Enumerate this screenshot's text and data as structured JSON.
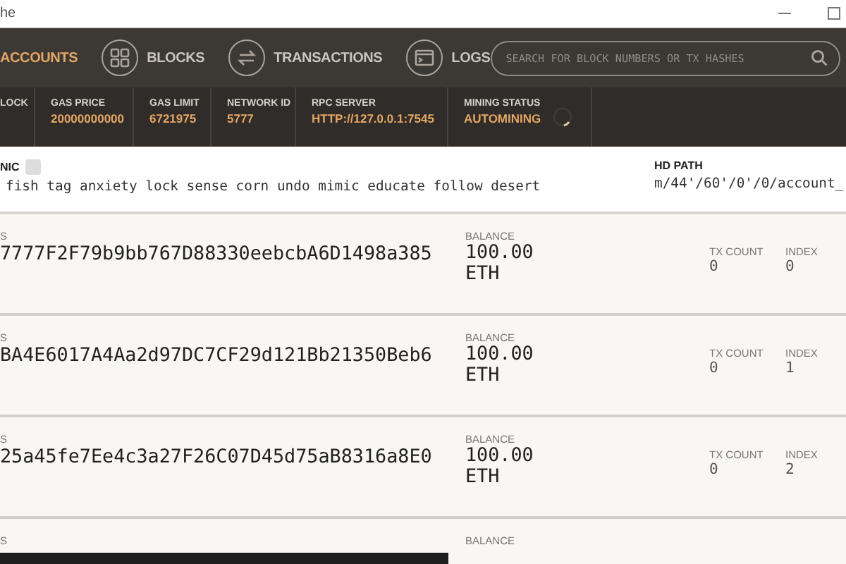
{
  "window": {
    "title": "he"
  },
  "nav": {
    "items": [
      {
        "label": "ACCOUNTS",
        "selected": true
      },
      {
        "label": "BLOCKS",
        "selected": false
      },
      {
        "label": "TRANSACTIONS",
        "selected": false
      },
      {
        "label": "LOGS",
        "selected": false
      }
    ],
    "search": {
      "placeholder": "SEARCH FOR BLOCK NUMBERS OR TX HASHES"
    }
  },
  "stats": [
    {
      "label": "LOCK"
    },
    {
      "label": "GAS PRICE",
      "value": "20000000000"
    },
    {
      "label": "GAS LIMIT",
      "value": "6721975"
    },
    {
      "label": "NETWORK ID",
      "value": "5777"
    },
    {
      "label": "RPC SERVER",
      "value": "HTTP://127.0.0.1:7545"
    },
    {
      "label": "MINING STATUS",
      "value": "AUTOMINING"
    }
  ],
  "mnemonic": {
    "label": "NIC",
    "words": "fish tag anxiety lock sense corn undo mimic educate follow desert"
  },
  "hd_path": {
    "label": "HD PATH",
    "value": "m/44'/60'/0'/0/account_"
  },
  "accounts": [
    {
      "address_label": "S",
      "address": "7777F2F79b9bb767D88330eebcbA6D1498a385",
      "balance_label": "BALANCE",
      "balance": "100.00",
      "unit": "ETH",
      "tx_label": "TX COUNT",
      "tx_count": "0",
      "index_label": "INDEX",
      "index": "0"
    },
    {
      "address_label": "S",
      "address": "BA4E6017A4Aa2d97DC7CF29d121Bb21350Beb6",
      "balance_label": "BALANCE",
      "balance": "100.00",
      "unit": "ETH",
      "tx_label": "TX COUNT",
      "tx_count": "0",
      "index_label": "INDEX",
      "index": "1"
    },
    {
      "address_label": "S",
      "address": "25a45fe7Ee4c3a27F26C07D45d75aB8316a8E0",
      "balance_label": "BALANCE",
      "balance": "100.00",
      "unit": "ETH",
      "tx_label": "TX COUNT",
      "tx_count": "0",
      "index_label": "INDEX",
      "index": "2"
    },
    {
      "address_label": "S",
      "balance_label": "BALANCE"
    }
  ]
}
